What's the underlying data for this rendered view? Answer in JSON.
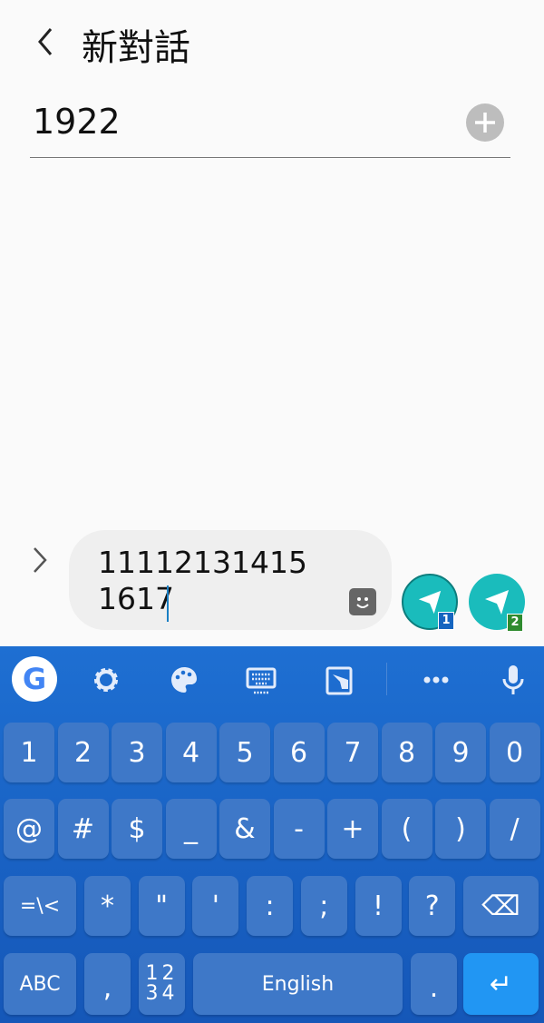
{
  "header": {
    "back_icon": "chevron-left-icon",
    "title": "新對話"
  },
  "recipient": {
    "value": "1922",
    "add_icon": "plus-circle-icon"
  },
  "composer": {
    "expand_icon": "chevron-right-icon",
    "message": "11112131415\n1617",
    "sticker_icon": "sticker-icon",
    "send_sim1_label": "1",
    "send_sim2_label": "2",
    "send_color": "#1abcbc",
    "sim1_color": "#1565c0",
    "sim2_color": "#2e8b2e"
  },
  "keyboard": {
    "toolbar": [
      "google-icon",
      "settings-gear-icon",
      "palette-icon",
      "keyboard-icon",
      "one-handed-icon",
      "more-icon",
      "microphone-icon"
    ],
    "google_label": "G",
    "rows": [
      [
        "1",
        "2",
        "3",
        "4",
        "5",
        "6",
        "7",
        "8",
        "9",
        "0"
      ],
      [
        "@",
        "#",
        "$",
        "_",
        "&",
        "-",
        "+",
        "(",
        ")",
        "/"
      ],
      [
        "=\\<",
        "*",
        "\"",
        "'",
        ":",
        ";",
        "!",
        "?",
        "⌫"
      ],
      [
        "ABC",
        ",",
        "12\n34",
        "English",
        ".",
        "↵"
      ]
    ],
    "enter_color": "#2196f3"
  }
}
